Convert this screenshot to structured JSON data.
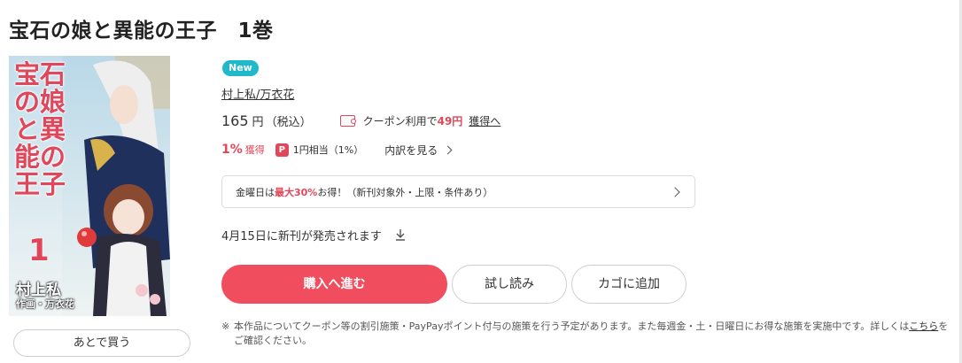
{
  "title": "宝石の娘と異能の王子　1巻",
  "cover": {
    "title_chars": "宝石の娘と異能の王子",
    "volume": "1",
    "author_credit": "村上私",
    "illustrator_credit": "作画・万衣花"
  },
  "later_button": "あとで買う",
  "badge": "New",
  "author": "村上私/万衣花",
  "price": {
    "amount": "165",
    "unit": "円",
    "tax": "（税込）"
  },
  "coupon": {
    "icon": "coupon-icon",
    "prefix": "クーポン利用で",
    "amount": "49円",
    "link": "獲得へ"
  },
  "points": {
    "rate": "1%",
    "label": "獲得",
    "paypay_icon": "P",
    "paypay_text": "1円相当（1%）",
    "breakdown": "内訳を見る"
  },
  "promo": {
    "prefix": "金曜日は",
    "emphasis": "最大30%",
    "suffix": "お得！（新刊対象外・上限・条件あり）"
  },
  "release": {
    "text": "4月15日に新刊が発売されます"
  },
  "buttons": {
    "buy": "購入へ進む",
    "trial": "試し読み",
    "cart": "カゴに追加"
  },
  "note": {
    "mark": "※",
    "text_before": "本作品についてクーポン等の割引施策・PayPayポイント付与の施策を行う予定があります。また毎週金・土・日曜日にお得な施策を実施中です。詳しくは",
    "link": "こちら",
    "text_after": "をご確認ください。"
  },
  "colors": {
    "accent": "#f04e5e",
    "badge": "#1fb9c9",
    "text": "#333333"
  }
}
